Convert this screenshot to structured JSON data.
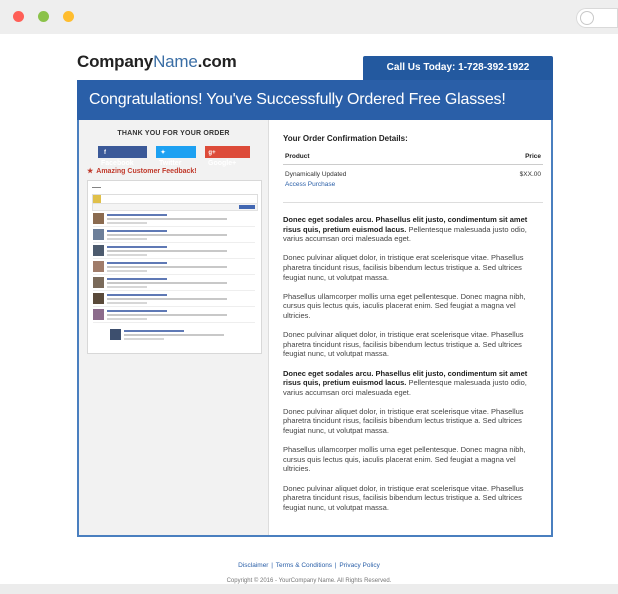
{
  "window": {
    "traffic_lights": [
      "close",
      "minimize",
      "zoom"
    ],
    "colors": {
      "red": "#ff5f57",
      "green": "#8bc24a",
      "yellow": "#ffbd2e"
    }
  },
  "header": {
    "logo_company": "Company",
    "logo_name": "Name",
    "logo_tld": ".com",
    "phone_label": "Call Us Today: 1-728-392-1922"
  },
  "banner": {
    "title": "Congratulations! You've Successfully Ordered Free Glasses!",
    "color": "#2a5fa8"
  },
  "sidebar": {
    "thank_you": "THANK YOU FOR YOUR ORDER",
    "social": [
      {
        "label": "Facebook",
        "icon": "facebook-icon",
        "color": "#3b5998"
      },
      {
        "label": "Twitter",
        "icon": "twitter-icon",
        "color": "#1da1f2"
      },
      {
        "label": "Google+",
        "icon": "google-plus-icon",
        "color": "#dd4b39"
      }
    ],
    "feedback_title": "Amazing Customer Feedback!"
  },
  "order": {
    "title": "Your Order Confirmation Details:",
    "col_product": "Product",
    "col_price": "Price",
    "product_name": "Dynamically Updated",
    "product_link": "Access Purchase",
    "product_price": "$XX.00"
  },
  "paragraphs": [
    {
      "bold": "Donec eget sodales arcu. Phasellus elit justo, condimentum sit amet risus quis, pretium euismod lacus.",
      "text": " Pellentesque malesuada justo odio, varius accumsan orci malesuada eget."
    },
    {
      "bold": "",
      "text": "Donec pulvinar aliquet dolor, in tristique erat scelerisque vitae. Phasellus pharetra tincidunt risus, facilisis bibendum lectus tristique a. Sed ultrices feugiat nunc, ut volutpat massa."
    },
    {
      "bold": "",
      "text": "Phasellus ullamcorper mollis urna eget pellentesque. Donec magna nibh, cursus quis lectus quis, iaculis placerat enim. Sed feugiat a magna vel ultricies."
    },
    {
      "bold": "",
      "text": "Donec pulvinar aliquet dolor, in tristique erat scelerisque vitae. Phasellus pharetra tincidunt risus, facilisis bibendum lectus tristique a. Sed ultrices feugiat nunc, ut volutpat massa."
    },
    {
      "bold": "Donec eget sodales arcu. Phasellus elit justo, condimentum sit amet risus quis, pretium euismod lacus.",
      "text": " Pellentesque malesuada justo odio, varius accumsan orci malesuada eget."
    },
    {
      "bold": "",
      "text": "Donec pulvinar aliquet dolor, in tristique erat scelerisque vitae. Phasellus pharetra tincidunt risus, facilisis bibendum lectus tristique a. Sed ultrices feugiat nunc, ut volutpat massa."
    },
    {
      "bold": "",
      "text": "Phasellus ullamcorper mollis urna eget pellentesque. Donec magna nibh, cursus quis lectus quis, iaculis placerat enim. Sed feugiat a magna vel ultricies."
    },
    {
      "bold": "",
      "text": "Donec pulvinar aliquet dolor, in tristique erat scelerisque vitae. Phasellus pharetra tincidunt risus, facilisis bibendum lectus tristique a. Sed ultrices feugiat nunc, ut volutpat massa."
    }
  ],
  "footer": {
    "disclaimer": "Disclaimer",
    "terms": "Terms & Conditions",
    "privacy": "Privacy Policy",
    "separator": "|",
    "copyright": "Copyright © 2016 - YourCompany Name. All Rights Reserved."
  }
}
